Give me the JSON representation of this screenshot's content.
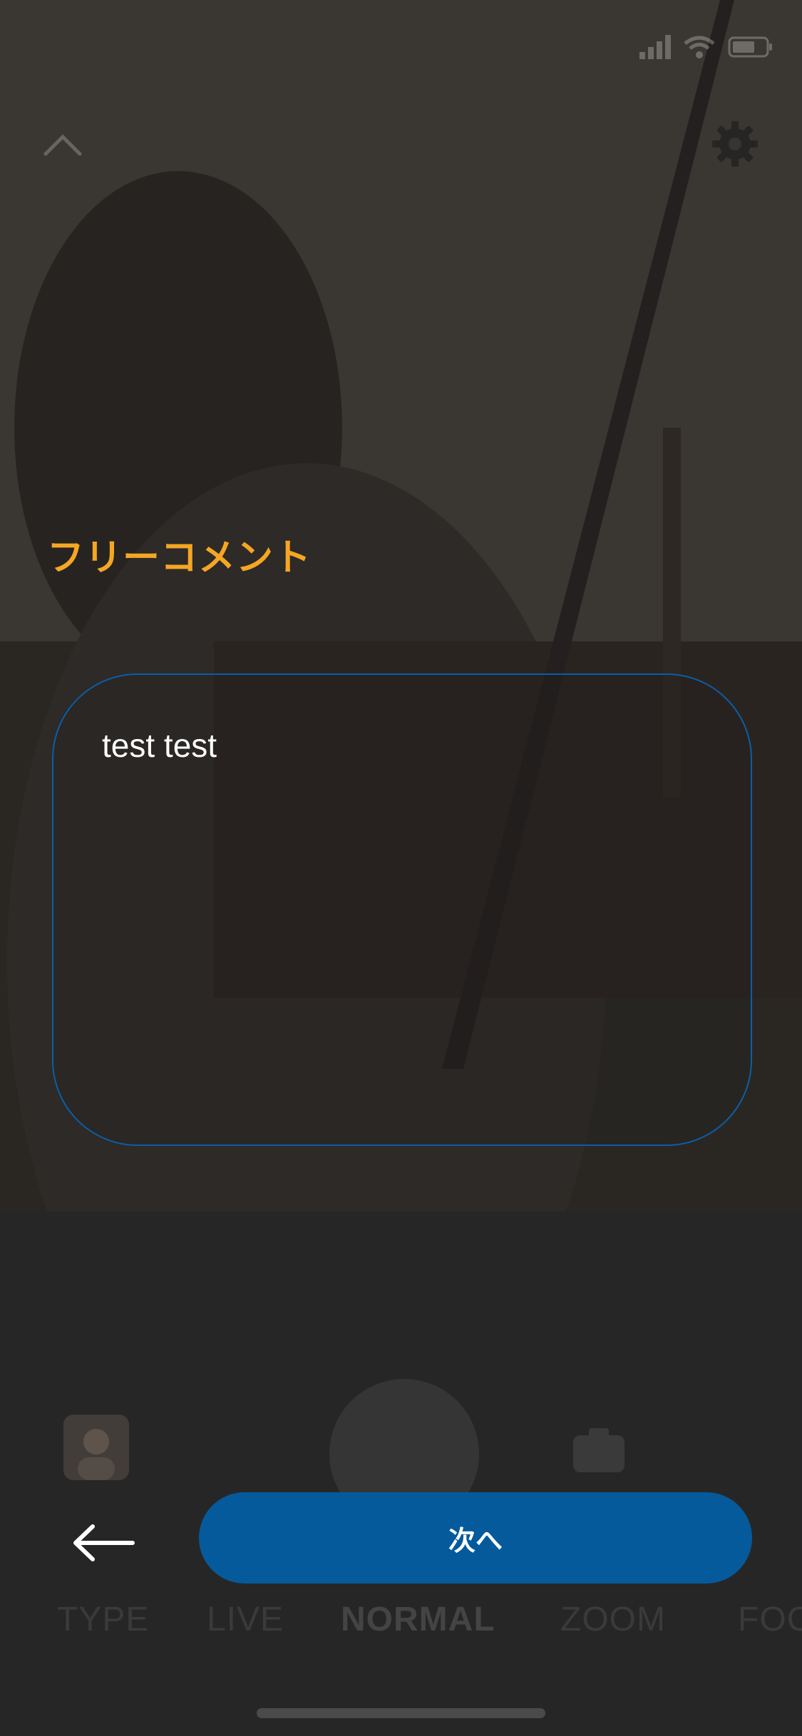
{
  "colors": {
    "title": "#f5a623",
    "accent": "#055a9c",
    "box_border": "#0a5ea8",
    "overlay": "#1e1e1e"
  },
  "header": {
    "collapse_icon": "chevron-up-icon",
    "settings_icon": "gear-icon"
  },
  "status_bar": {
    "icons": [
      "signal-icon",
      "wifi-icon",
      "battery-icon"
    ]
  },
  "comment": {
    "title": "フリーコメント",
    "value": "test test"
  },
  "actions": {
    "back_icon": "arrow-left-icon",
    "next_label": "次へ"
  },
  "modes": {
    "items": [
      "TYPE",
      "LIVE",
      "NORMAL",
      "ZOOM",
      "FOC"
    ],
    "selected": "NORMAL"
  }
}
